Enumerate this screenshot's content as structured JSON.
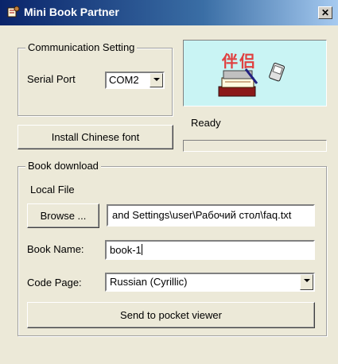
{
  "window": {
    "title": "Mini Book Partner"
  },
  "communication": {
    "group_title": "Communication Setting",
    "serial_port_label": "Serial Port",
    "serial_port_value": "COM2"
  },
  "logo": {
    "chinese_text": "伴侣"
  },
  "status": {
    "text": "Ready",
    "progress": 0
  },
  "install_font_label": "Install Chinese font",
  "book_download": {
    "group_title": "Book download",
    "local_file_label": "Local File",
    "browse_label": "Browse ...",
    "file_path": "and Settings\\user\\Рабочий стол\\faq.txt",
    "book_name_label": "Book Name:",
    "book_name_value": "book-1",
    "code_page_label": "Code Page:",
    "code_page_value": "Russian (Cyrillic)",
    "send_label": "Send to pocket viewer"
  },
  "colors": {
    "titlebar": "#0a246a",
    "window": "#ece9d8",
    "logo_bg": "#c9f4f4",
    "logo_text": "#e04040"
  }
}
